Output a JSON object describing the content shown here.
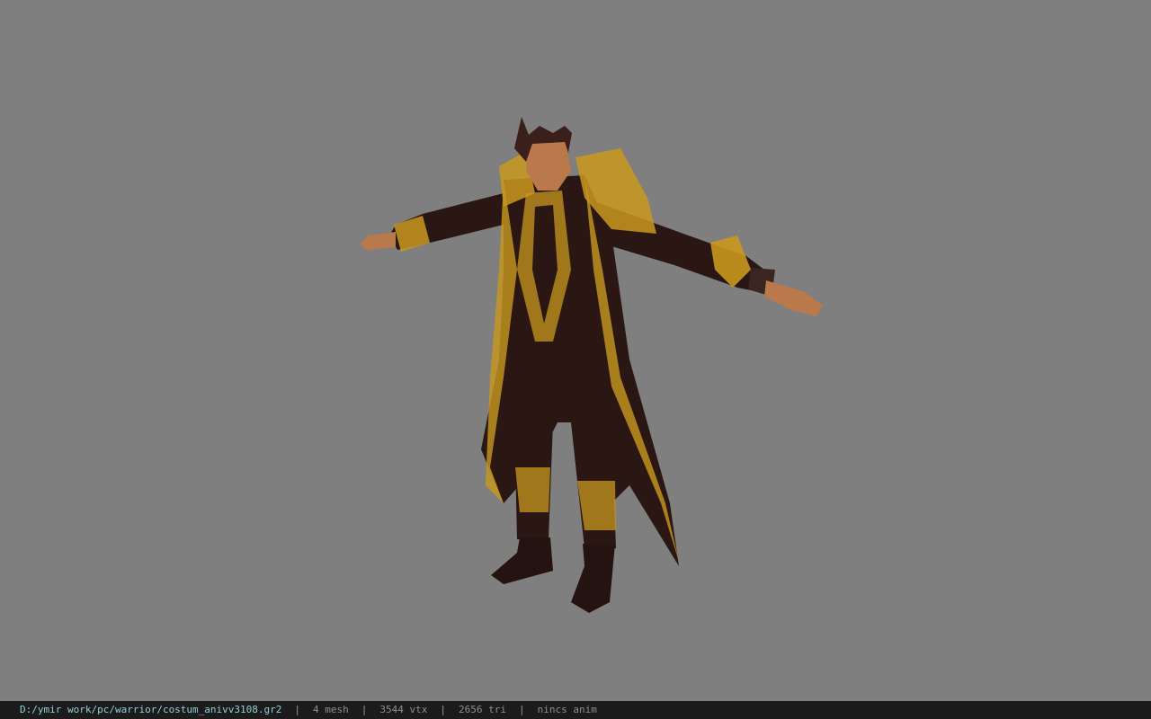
{
  "viewport": {
    "background_color": "#7f7f7f",
    "model": {
      "icon": "character-model-warrior-costume",
      "coat_color": "#2a1714",
      "trim_color": "#c9981e",
      "skin_color": "#b9794a"
    }
  },
  "statusbar": {
    "path": "D:/ymir work/pc/warrior/costum_anivv3108.gr2",
    "separator": "|",
    "mesh": "4 mesh",
    "vtx": "3544 vtx",
    "tri": "2656 tri",
    "anim": "nincs anim",
    "path_color": "#8fd0d8",
    "background_color": "#1b1b1b"
  }
}
